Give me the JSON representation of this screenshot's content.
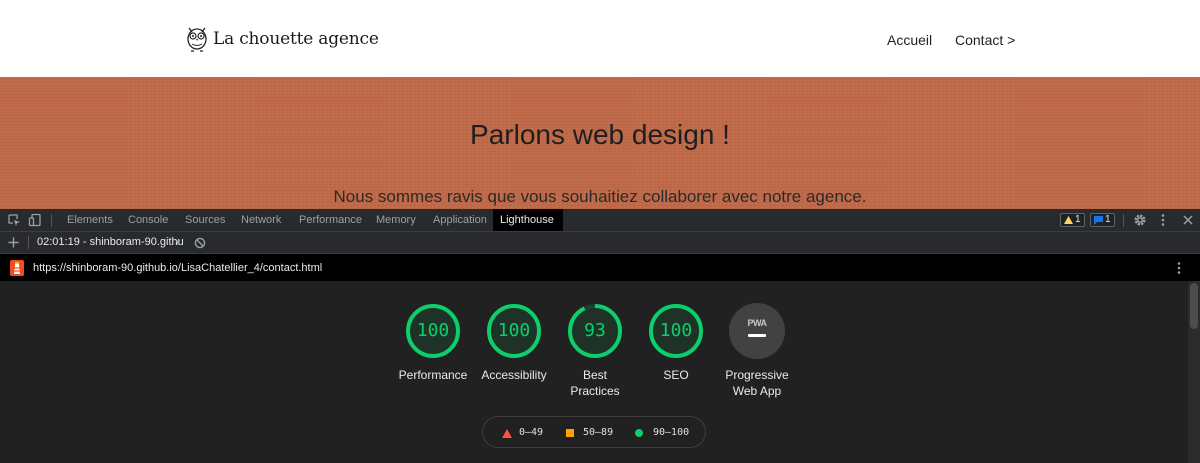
{
  "site": {
    "logo_text": "La chouette agence",
    "nav": {
      "home": "Accueil",
      "contact": "Contact >"
    },
    "hero_title": "Parlons web design !",
    "hero_subtitle": "Nous sommes ravis que vous souhaitiez collaborer avec notre agence."
  },
  "devtools": {
    "tabs": [
      "Elements",
      "Console",
      "Sources",
      "Network",
      "Performance",
      "Memory",
      "Application",
      "Lighthouse"
    ],
    "active_tab": "Lighthouse",
    "warning_count": "1",
    "message_count": "1",
    "report_select": "02:01:19 - shinboram-90.githu",
    "url": "https://shinboram-90.github.io/LisaChatellier_4/contact.html"
  },
  "lighthouse": {
    "colors": {
      "pass": "#0cce6b",
      "average": "#ffa400",
      "fail": "#ff4e42"
    },
    "scores": [
      {
        "label": "Performance",
        "value": "100",
        "score": 100
      },
      {
        "label": "Accessibility",
        "value": "100",
        "score": 100
      },
      {
        "label": "Best\nPractices",
        "value": "93",
        "score": 93
      },
      {
        "label": "SEO",
        "value": "100",
        "score": 100
      }
    ],
    "pwa": {
      "badge": "PWA",
      "label": "Progressive\nWeb App"
    },
    "legend": {
      "fail": "0–49",
      "average": "50–89",
      "pass": "90–100"
    }
  }
}
